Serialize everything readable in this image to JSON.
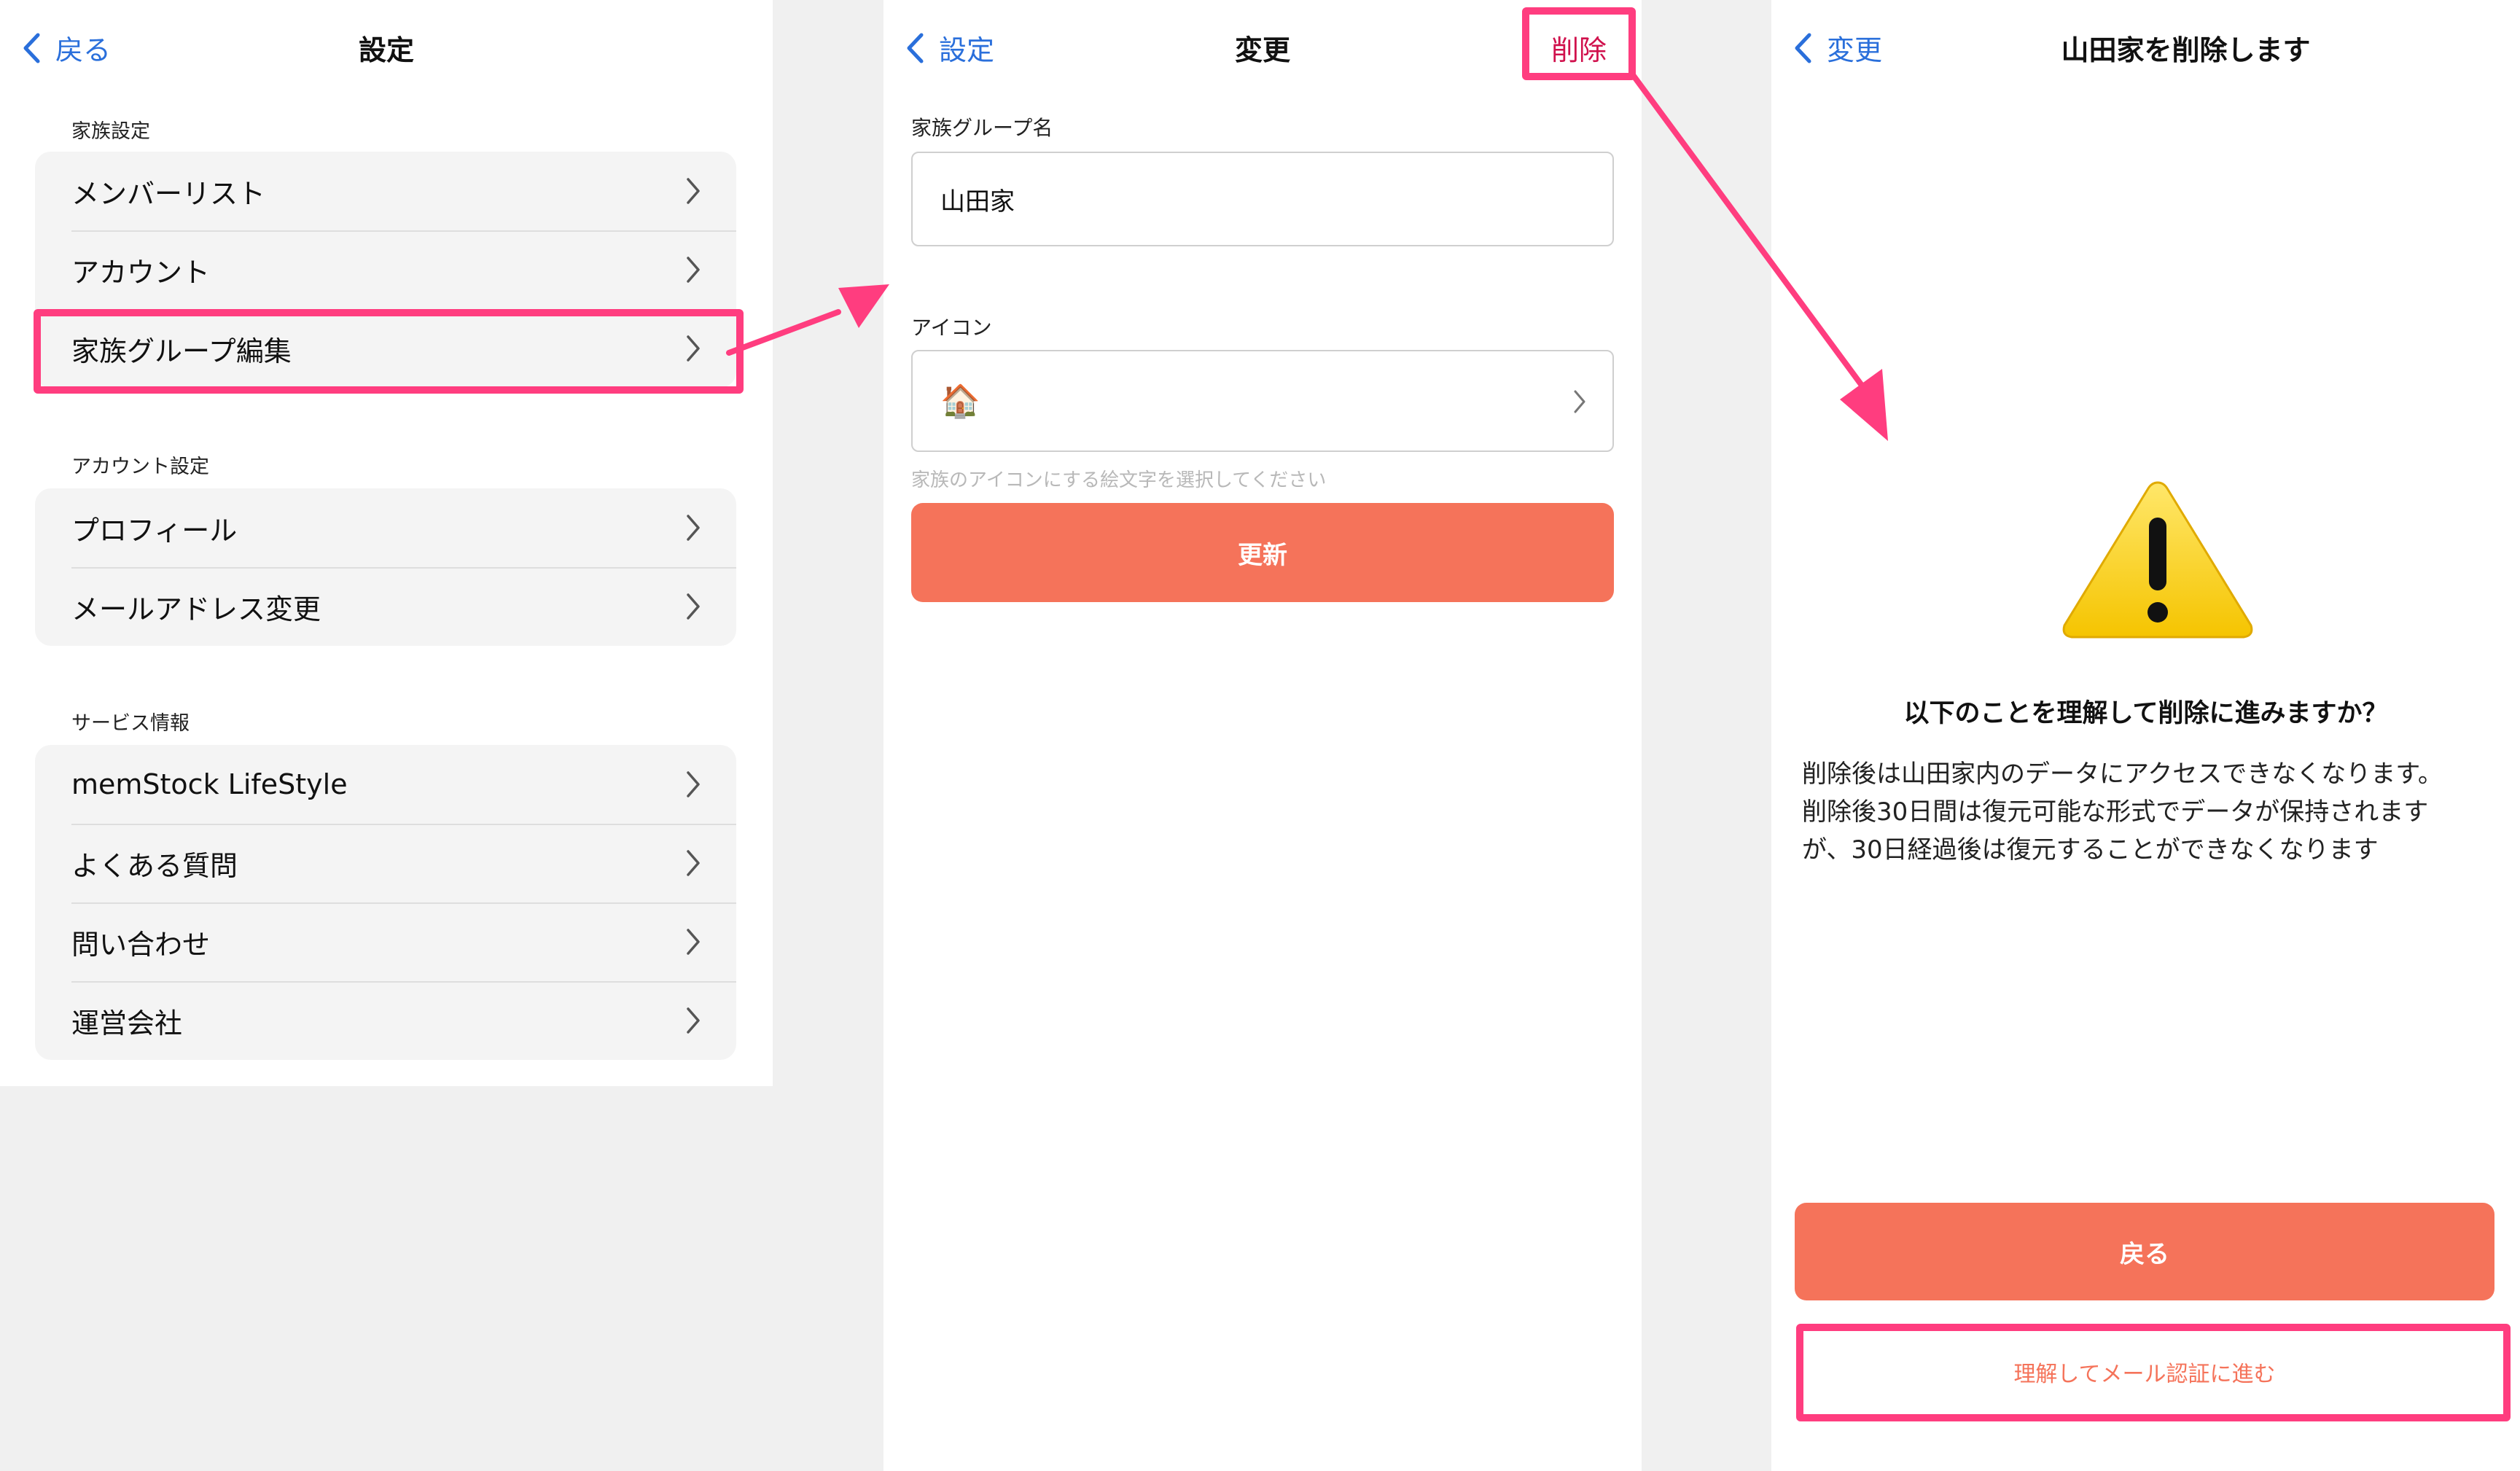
{
  "screen1": {
    "back_label": "戻る",
    "title": "設定",
    "sections": [
      {
        "label": "家族設定",
        "items": [
          "メンバーリスト",
          "アカウント",
          "家族グループ編集"
        ]
      },
      {
        "label": "アカウント設定",
        "items": [
          "プロフィール",
          "メールアドレス変更"
        ]
      },
      {
        "label": "サービス情報",
        "items": [
          "memStock LifeStyle",
          "よくある質問",
          "問い合わせ",
          "運営会社"
        ]
      }
    ]
  },
  "screen2": {
    "back_label": "設定",
    "title": "変更",
    "delete_label": "削除",
    "group_name_label": "家族グループ名",
    "group_name_value": "山田家",
    "icon_label": "アイコン",
    "icon_value": "🏠",
    "icon_hint": "家族のアイコンにする絵文字を選択してください",
    "update_button": "更新"
  },
  "screen3": {
    "back_label": "変更",
    "title": "山田家を削除します",
    "question": "以下のことを理解して削除に進みますか？",
    "body_lines": [
      "削除後は山田家内のデータにアクセスできなくなります。",
      "削除後30日間は復元可能な形式でデータが保持されます",
      "が、30日経過後は復元することができなくなります"
    ],
    "back_button": "戻る",
    "proceed_button": "理解してメール認証に進む"
  },
  "colors": {
    "accent_button": "#f5735a",
    "link_blue": "#2a6fdb",
    "delete_red": "#d0104c",
    "highlight": "#ff3d7f"
  },
  "icons": [
    "back-chevron-icon",
    "chevron-right-icon",
    "house-emoji-icon",
    "warning-icon"
  ]
}
